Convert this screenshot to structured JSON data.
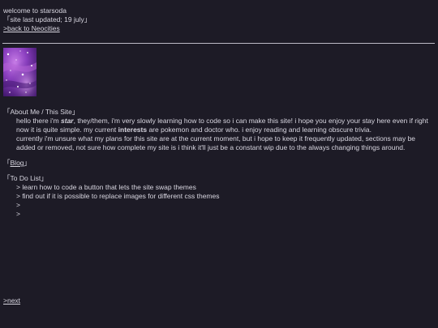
{
  "header": {
    "welcome": "welcome to starsoda",
    "updated": "「site last updated; 19 july」",
    "back_link": ">back to Neocities"
  },
  "avatar": {
    "description_icon": "galaxy-avatar-image",
    "color": "#8a3fbf"
  },
  "about": {
    "heading": "「About Me / This Site」",
    "p1_a": "hello there i'm ",
    "p1_name": "star",
    "p1_b": ", they/them, i'm very slowly learning how to code so i can make this site! i hope you enjoy your stay here even if right now it is quite simple. my current ",
    "p1_interests": "interests",
    "p1_c": " are pokemon and doctor who. i enjoy reading and learning obscure trivia.",
    "p2": "currently i'm unsure what my plans for this site are at the current moment, but i hope to keep it frequently updated, sections may be added or removed, not sure how complete my site is i think it'll just be a constant wip due to the always changing things around."
  },
  "blog": {
    "open": "「",
    "label": "Blog",
    "close": "」"
  },
  "todo": {
    "heading": "「To Do List」",
    "items": [
      "> learn how to code a button that lets the site swap themes",
      "> find out if it is possible to replace images for different css themes",
      ">",
      ">"
    ]
  },
  "footer": {
    "next_link": ">next"
  }
}
